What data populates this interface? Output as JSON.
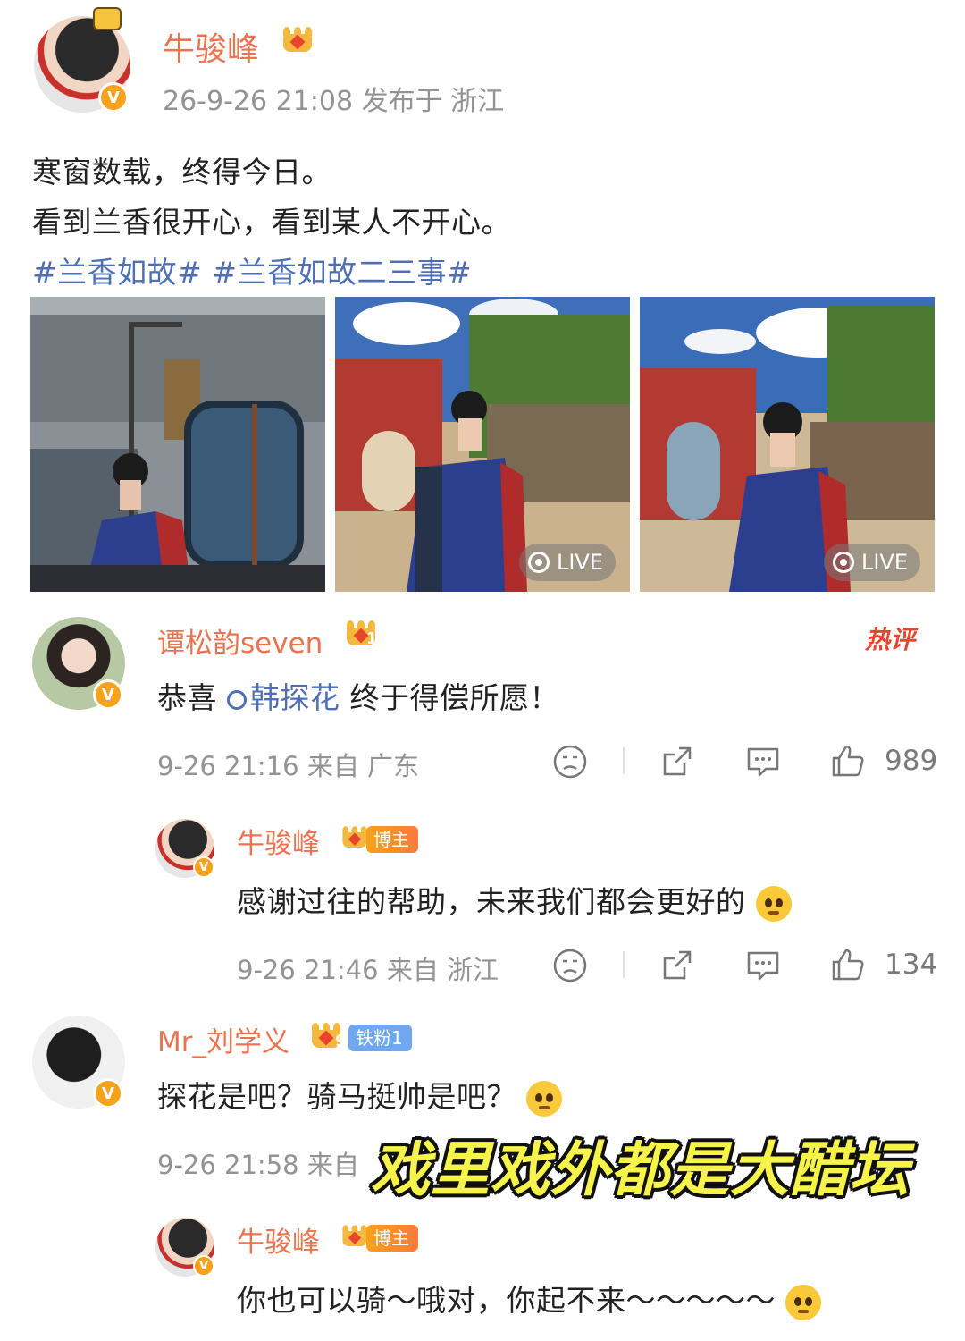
{
  "post": {
    "author": "牛骏峰",
    "time_location": "26-9-26 21:08  发布于 浙江",
    "line1": "寒窗数载，终得今日。",
    "line2": "看到兰香很开心，看到某人不开心。",
    "topic1": "#兰香如故#",
    "topic2": "#兰香如故二三事#",
    "live_label": "LIVE"
  },
  "comments": [
    {
      "author": "谭松韵seven",
      "badge_level": "10",
      "hot_label": "热评",
      "prefix": "恭喜 ",
      "mention": "韩探花",
      "suffix": " 终于得偿所愿！",
      "meta": "9-26 21:16  来自 广东",
      "likes": "989",
      "reply": {
        "author": "牛骏峰",
        "tag": "博主",
        "text": "感谢过往的帮助，未来我们都会更好的",
        "meta": "9-26 21:46  来自 浙江",
        "likes": "134"
      }
    },
    {
      "author": "Mr_刘学义",
      "badge_level": "9",
      "tag": "铁粉1",
      "text": "探花是吧？骑马挺帅是吧？",
      "meta": "9-26 21:58  来自",
      "reply": {
        "author": "牛骏峰",
        "tag": "博主",
        "text": "你也可以骑～哦对，你起不来～～～～～"
      }
    }
  ],
  "overlay_caption": "戏里戏外都是大醋坛",
  "colors": {
    "name": "#eb7350",
    "link": "#4e6fb3",
    "meta": "#939393",
    "caption": "#f6f34b"
  },
  "icons": [
    "verified-icon",
    "crown-badge-icon",
    "live-icon",
    "search-icon",
    "dislike-icon",
    "share-icon",
    "comment-icon",
    "like-icon",
    "emoji-icon"
  ]
}
